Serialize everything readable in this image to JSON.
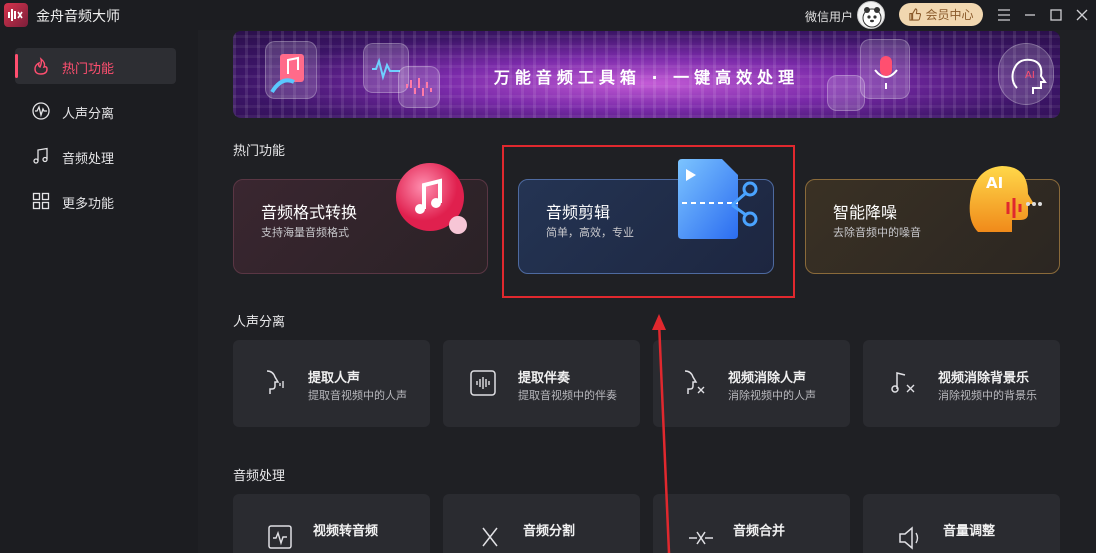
{
  "app": {
    "title": "金舟音频大师"
  },
  "header": {
    "user_name": "微信用户",
    "member_label": "会员中心"
  },
  "sidebar": {
    "items": [
      {
        "label": "热门功能",
        "active": true,
        "icon": "hot-icon"
      },
      {
        "label": "人声分离",
        "active": false,
        "icon": "waveform-icon"
      },
      {
        "label": "音频处理",
        "active": false,
        "icon": "music-note-icon"
      },
      {
        "label": "更多功能",
        "active": false,
        "icon": "grid-icon"
      }
    ]
  },
  "banner": {
    "text": "万能音频工具箱 · 一键高效处理"
  },
  "sections": {
    "hot": "热门功能",
    "vocal": "人声分离",
    "audio": "音频处理"
  },
  "hot_cards": [
    {
      "title": "音频格式转换",
      "subtitle": "支持海量音频格式",
      "icon": "format-convert-icon"
    },
    {
      "title": "音频剪辑",
      "subtitle": "简单，高效，专业",
      "icon": "audio-cut-icon"
    },
    {
      "title": "智能降噪",
      "subtitle": "去除音频中的噪音",
      "icon": "ai-denoise-icon",
      "badge": "AI"
    }
  ],
  "vocal_tools": [
    {
      "title": "提取人声",
      "subtitle": "提取音视频中的人声",
      "icon": "voice-extract-icon"
    },
    {
      "title": "提取伴奏",
      "subtitle": "提取音视频中的伴奏",
      "icon": "accompaniment-icon"
    },
    {
      "title": "视频消除人声",
      "subtitle": "消除视频中的人声",
      "icon": "voice-remove-icon"
    },
    {
      "title": "视频消除背景乐",
      "subtitle": "消除视频中的背景乐",
      "icon": "music-remove-icon"
    }
  ],
  "audio_tools": [
    {
      "title": "视频转音频",
      "icon": "video-to-audio-icon"
    },
    {
      "title": "音频分割",
      "icon": "scissors-icon"
    },
    {
      "title": "音频合并",
      "icon": "merge-icon"
    },
    {
      "title": "音量调整",
      "icon": "volume-icon"
    }
  ],
  "colors": {
    "accent": "#ff4f70",
    "highlight": "#e0282e",
    "background": "#1f2024"
  }
}
